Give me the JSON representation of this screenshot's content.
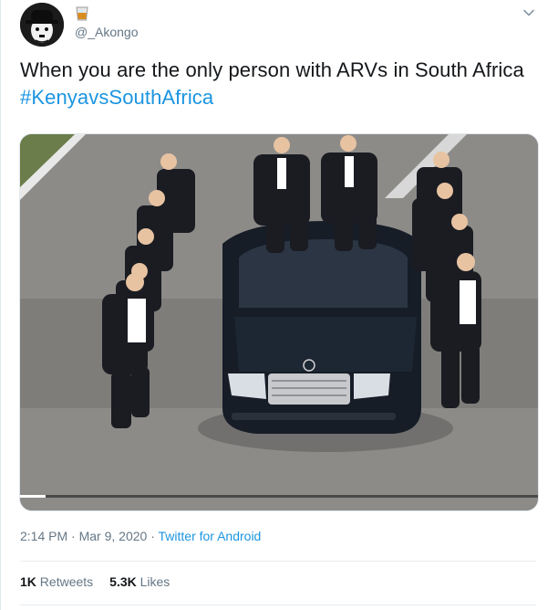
{
  "author": {
    "handle": "@_Akongo",
    "avatar_icon": "chaplin-avatar",
    "badge_icon": "whisky-glass-emoji"
  },
  "menu_icon": "chevron-down-icon",
  "tweet": {
    "text": "When you are the only person with ARVs in South Africa ",
    "hashtag": "#KenyavsSouthAfrica"
  },
  "media": {
    "kind": "video",
    "progress": 0.05
  },
  "meta": {
    "time": "2:14 PM",
    "sep1": " · ",
    "date": "Mar 9, 2020",
    "sep2": " · ",
    "source": "Twitter for Android"
  },
  "stats": {
    "retweets_count": "1K",
    "retweets_label": "Retweets",
    "likes_count": "5.3K",
    "likes_label": "Likes"
  },
  "colors": {
    "link": "#1b95e0",
    "secondary_text": "#657786",
    "primary_text": "#14171a",
    "border": "#e1e8ed"
  }
}
